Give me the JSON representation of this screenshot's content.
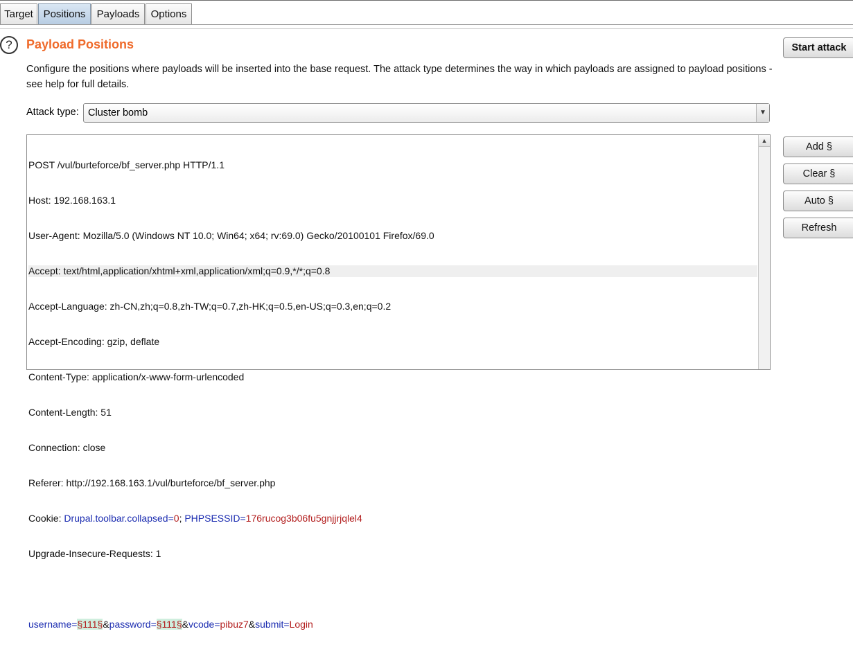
{
  "tabs": [
    {
      "label": "Target"
    },
    {
      "label": "Positions",
      "active": true
    },
    {
      "label": "Payloads"
    },
    {
      "label": "Options"
    }
  ],
  "section": {
    "help_icon": "?",
    "title": "Payload Positions",
    "description": "Configure the positions where payloads will be inserted into the base request. The attack type determines the way in which payloads are assigned to payload positions - see help for full details."
  },
  "attack": {
    "label": "Attack type:",
    "value": "Cluster bomb"
  },
  "buttons": {
    "start_attack": "Start attack",
    "add": "Add §",
    "clear": "Clear §",
    "auto": "Auto §",
    "refresh": "Refresh"
  },
  "request": {
    "line1": "POST /vul/burteforce/bf_server.php HTTP/1.1",
    "line2": "Host: 192.168.163.1",
    "line3": "User-Agent: Mozilla/5.0 (Windows NT 10.0; Win64; x64; rv:69.0) Gecko/20100101 Firefox/69.0",
    "line4": "Accept: text/html,application/xhtml+xml,application/xml;q=0.9,*/*;q=0.8",
    "line5": "Accept-Language: zh-CN,zh;q=0.8,zh-TW;q=0.7,zh-HK;q=0.5,en-US;q=0.3,en;q=0.2",
    "line6": "Accept-Encoding: gzip, deflate",
    "line7": "Content-Type: application/x-www-form-urlencoded",
    "line8": "Content-Length: 51",
    "line9": "Connection: close",
    "line10": "Referer: http://192.168.163.1/vul/burteforce/bf_server.php",
    "cookie": {
      "prefix": "Cookie: ",
      "k1": "Drupal.toolbar.collapsed",
      "eq1": "=",
      "v1": "0",
      "sep": "; ",
      "k2": "PHPSESSID",
      "eq2": "=",
      "v2": "176rucog3b06fu5gnjjrjqlel4"
    },
    "line12": "Upgrade-Insecure-Requests: 1",
    "body": {
      "k_user": "username",
      "eq": "=",
      "p_user": "§111§",
      "amp1": "&",
      "k_pass": "password",
      "p_pass": "§111§",
      "amp2": "&",
      "k_vcode": "vcode",
      "v_vcode": "pibuz7",
      "amp3": "&",
      "k_submit": "submit",
      "v_submit": "Login"
    }
  },
  "colors": {
    "title": "#ef6a2a",
    "param_key": "#1a2bb0",
    "param_value": "#b21c1c",
    "marker_bg": "#cfeede"
  },
  "icons": {
    "help": "help-icon",
    "dropdown": "chevron-down-icon",
    "scroll_up": "arrow-up-icon"
  }
}
